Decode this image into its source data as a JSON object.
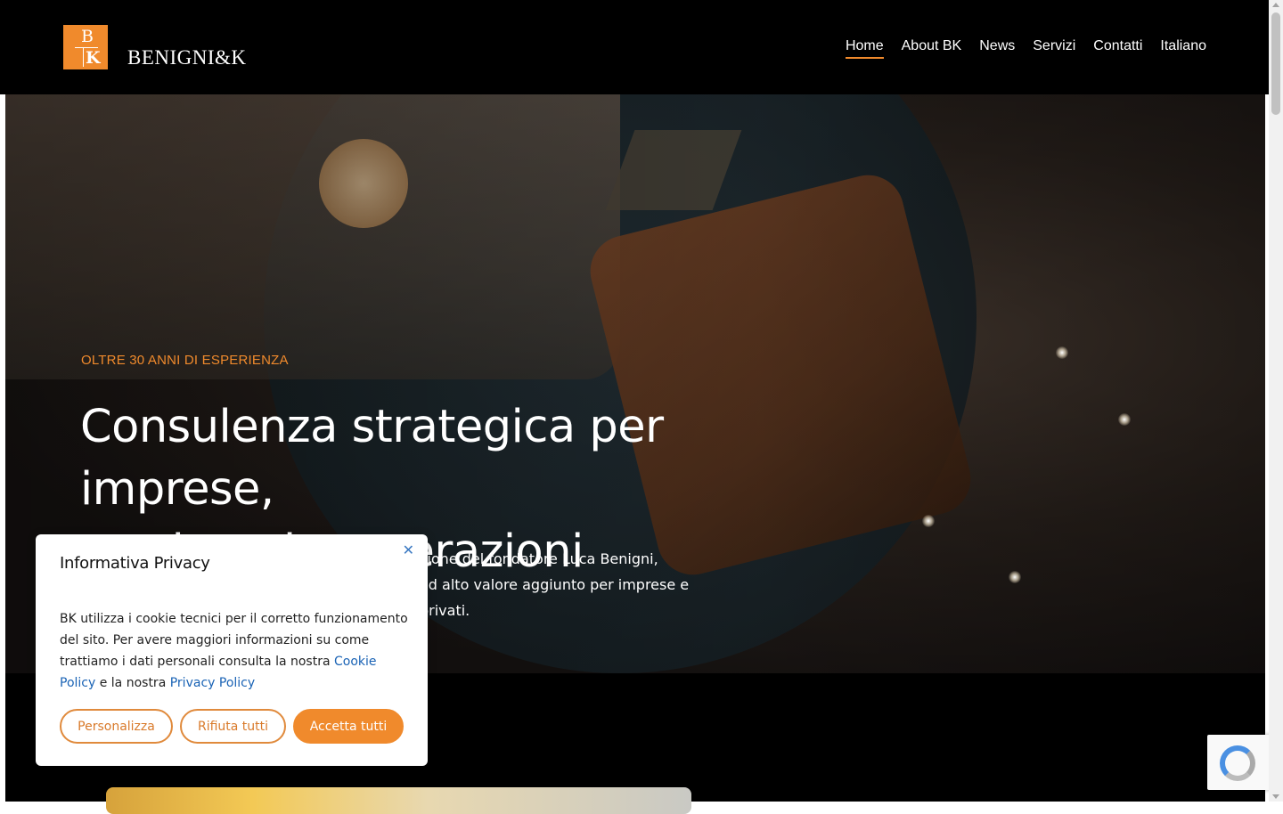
{
  "brand": {
    "name": "BENIGNI&K",
    "mark_top": "B",
    "mark_bottom": "K",
    "accent_color": "#f08a2c"
  },
  "nav": {
    "items": [
      {
        "label": "Home",
        "active": true
      },
      {
        "label": "About BK"
      },
      {
        "label": "News"
      },
      {
        "label": "Servizi"
      },
      {
        "label": "Contatti"
      },
      {
        "label": "Italiano"
      }
    ]
  },
  "hero": {
    "eyebrow": "OLTRE 30 ANNI DI ESPERIENZA",
    "title_line1": "Consulenza strategica per imprese,",
    "title_line2": "patrimoni e operazioni straordinarie",
    "subtitle_line1": "zione del fondatore Luca Benigni,",
    "subtitle_line2": "ad alto valore aggiunto per imprese e privati."
  },
  "cookie": {
    "title": "Informativa Privacy",
    "close_icon": "close-icon",
    "body_prefix": "BK utilizza i cookie tecnici per il corretto funzionamento del sito. Per avere maggiori informazioni su come trattiamo i dati personali consulta la nostra ",
    "cookie_policy_link": "Cookie Policy",
    "body_mid": " e la nostra ",
    "privacy_policy_link": "Privacy Policy",
    "buttons": {
      "customize": "Personalizza",
      "reject": "Rifiuta tutti",
      "accept": "Accetta tutti"
    }
  },
  "recaptcha": {
    "icon": "recaptcha-icon"
  }
}
